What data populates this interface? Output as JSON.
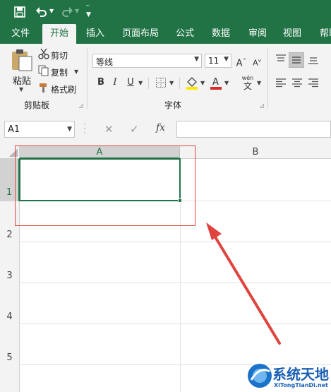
{
  "quick_access": {
    "icons": [
      "save-icon",
      "undo-icon",
      "redo-icon",
      "customize-icon"
    ]
  },
  "tabs": [
    {
      "label": "文件",
      "active": false
    },
    {
      "label": "开始",
      "active": true
    },
    {
      "label": "插入",
      "active": false
    },
    {
      "label": "页面布局",
      "active": false
    },
    {
      "label": "公式",
      "active": false
    },
    {
      "label": "数据",
      "active": false
    },
    {
      "label": "审阅",
      "active": false
    },
    {
      "label": "视图",
      "active": false
    },
    {
      "label": "帮助",
      "active": false
    }
  ],
  "clipboard": {
    "paste_label": "粘贴",
    "cut_label": "剪切",
    "copy_label": "复制",
    "format_painter_label": "格式刷",
    "group_label": "剪贴板"
  },
  "font": {
    "family": "等线",
    "size": "11",
    "group_label": "字体",
    "bold": "B",
    "italic": "I",
    "underline": "U",
    "wen_label": "wén",
    "wen_char": "文"
  },
  "formula_bar": {
    "name_box": "A1",
    "fx": "fx",
    "formula": ""
  },
  "sheet": {
    "columns": [
      "A",
      "B"
    ],
    "rows": [
      "1",
      "2",
      "3",
      "4",
      "5"
    ],
    "selected_cell": "A1"
  },
  "watermark": {
    "name": "系统天地",
    "url": "XiTongTianDi.net"
  },
  "colors": {
    "excel_green": "#217346",
    "annotation_red": "#e0443e",
    "font_color": "#d92b2b",
    "highlight": "#ffe600"
  }
}
